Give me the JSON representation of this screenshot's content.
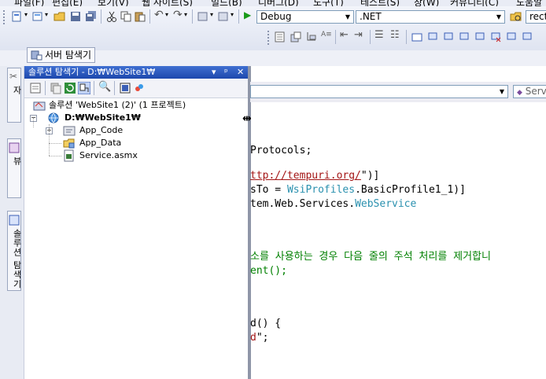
{
  "menu": {
    "items": [
      "파일(F)",
      "편집(E)",
      "보기(V)",
      "웹 사이트(S)",
      "빌드(B)",
      "디버그(D)",
      "도구(T)",
      "테스트(S)",
      "창(W)",
      "커뮤니티(C)",
      "도움말"
    ]
  },
  "toolbar": {
    "config_combo": "Debug",
    "platform_combo": ".NET",
    "find_text": "rect"
  },
  "server_explorer": {
    "label": "서버 탐색기"
  },
  "left_tabs": [
    "도구 상자",
    "클래스 뷰",
    "솔루션 탐색기"
  ],
  "solution_explorer": {
    "title": "솔루션 탐색기 - D:₩WebSite1₩",
    "buttons": [
      "▾",
      "ᵖ",
      "✕"
    ],
    "tree": {
      "solution": "솔루션 'WebSite1 (2)' (1 프로젝트)",
      "project": "D:₩WebSite1₩",
      "items": [
        "App_Code",
        "App_Data",
        "Service.asmx"
      ]
    }
  },
  "editor": {
    "member_combo": "Serv",
    "code": {
      "l1": "Protocols;",
      "l2a": "ttp://tempuri.org/",
      "l2b": "\")]",
      "l3a": "sTo = ",
      "l3b": "WsiProfiles",
      "l3c": ".BasicProfile1_1)]",
      "l4a": "tem.Web.Services.",
      "l4b": "WebService",
      "l5": "소를 사용하는 경우 다음 줄의 주석 처리를 제거합니",
      "l6": "ent();",
      "l7": "d() {",
      "l8a": "d",
      "l8b": "\";"
    }
  },
  "colors": {
    "accent": "#1d48ad",
    "keyword": "#2b91af",
    "string": "#a31515",
    "comment": "#008000"
  }
}
